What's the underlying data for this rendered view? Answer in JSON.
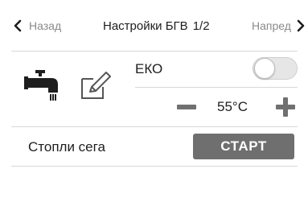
{
  "header": {
    "back_label": "Назад",
    "title": "Настройки БГВ",
    "page_indicator": "1/2",
    "next_label": "Напред"
  },
  "eko": {
    "label": "ЕКО",
    "enabled": false
  },
  "temperature": {
    "value": "55°C"
  },
  "heat_now": {
    "label": "Стопли сега",
    "button_label": "СТАРТ"
  },
  "colors": {
    "icon_dark": "#1e1e1e",
    "button_bg": "#6f6f6f",
    "muted_text": "#8a8a8a",
    "divider": "#d8d8d8"
  }
}
